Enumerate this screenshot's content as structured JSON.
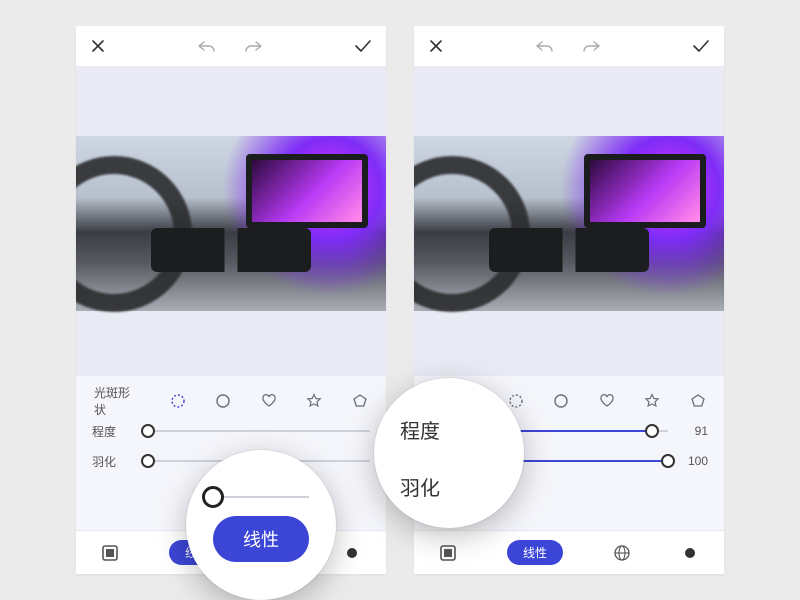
{
  "topbar": {
    "close_icon": "close",
    "undo_icon": "undo",
    "redo_icon": "redo",
    "confirm_icon": "check"
  },
  "left": {
    "shape_label": "光斑形状",
    "degree_label": "程度",
    "feather_label": "羽化",
    "degree_value": 0,
    "feather_value": 0,
    "pill_label": "线性",
    "zoom_pill_label": "线性"
  },
  "right": {
    "shape_label": "",
    "degree_label": "程度",
    "feather_label": "羽化",
    "degree_value": 91,
    "feather_value": 100,
    "pill_label": "线性",
    "zoom_label_top": "程度",
    "zoom_label_bottom": "羽化"
  },
  "shapes": [
    "dotted-circle",
    "circle",
    "heart",
    "star",
    "pentagon"
  ],
  "bottom_nav": [
    "square-stack",
    "pill",
    "globe",
    "dot"
  ],
  "colors": {
    "accent": "#3c46d6"
  }
}
